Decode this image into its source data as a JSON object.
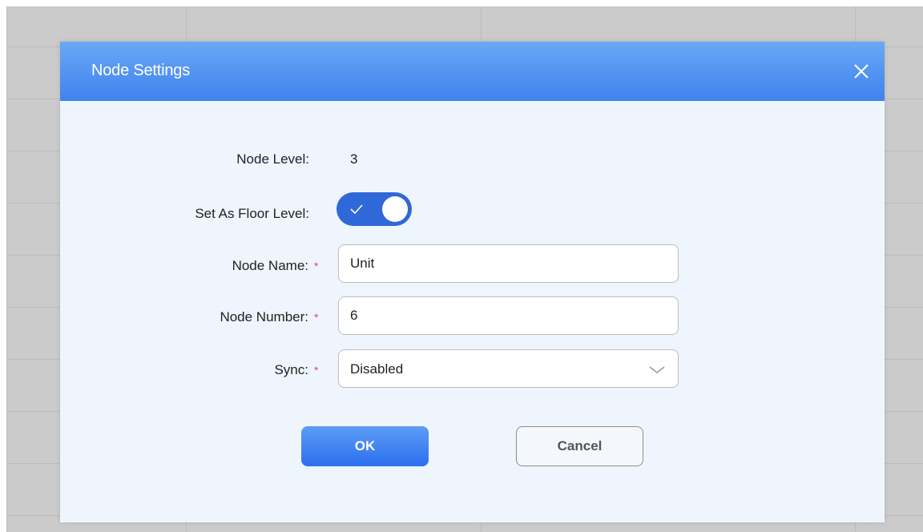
{
  "dialog": {
    "title": "Node Settings"
  },
  "form": {
    "node_level": {
      "label": "Node Level:",
      "value": "3"
    },
    "floor_level": {
      "label": "Set As Floor Level:",
      "enabled": true
    },
    "node_name": {
      "label": "Node Name:",
      "required_marker": "*",
      "value": "Unit"
    },
    "node_number": {
      "label": "Node Number:",
      "required_marker": "*",
      "value": "6"
    },
    "sync": {
      "label": "Sync:",
      "required_marker": "*",
      "selected": "Disabled"
    }
  },
  "buttons": {
    "ok_label": "OK",
    "cancel_label": "Cancel"
  },
  "colors": {
    "header_top": "#6aa8f5",
    "header_bottom": "#3f82ee",
    "toggle_on": "#2f68d8",
    "required": "#e24d4d",
    "dialog_bg": "#eef5fc"
  }
}
